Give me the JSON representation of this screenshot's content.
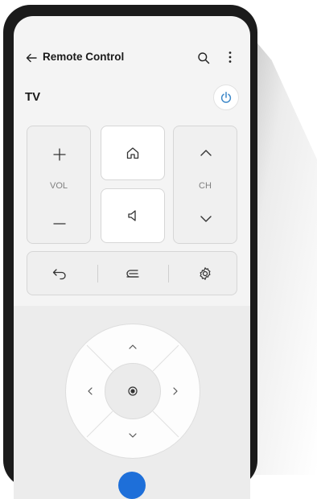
{
  "header": {
    "title": "Remote Control"
  },
  "device": {
    "name": "TV"
  },
  "volume": {
    "label": "VOL"
  },
  "channel": {
    "label": "CH"
  },
  "icons": {
    "back": "arrow-left-icon",
    "search": "search-icon",
    "more": "more-vertical-icon",
    "power": "power-icon",
    "home": "home-icon",
    "mute": "speaker-icon",
    "return": "return-icon",
    "input": "input-source-icon",
    "settings": "gear-icon"
  },
  "colors": {
    "power_accent": "#3a86c8",
    "peek_button": "#1e6fd9"
  }
}
